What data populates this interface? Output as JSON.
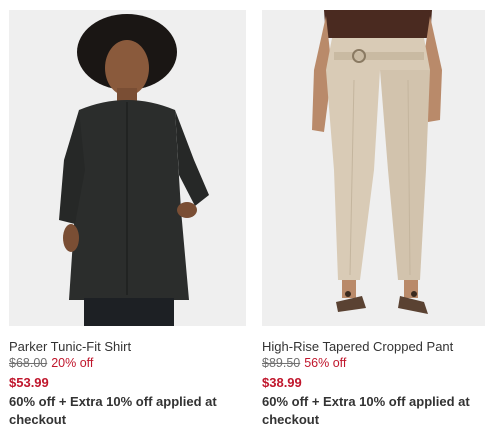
{
  "products": [
    {
      "name": "Parker Tunic-Fit Shirt",
      "original_price": "$68.00",
      "discount": "20% off",
      "sale_price": "$53.99",
      "promo": "60% off + Extra 10% off applied at checkout"
    },
    {
      "name": "High-Rise Tapered Cropped Pant",
      "original_price": "$89.50",
      "discount": "56% off",
      "sale_price": "$38.99",
      "promo": "60% off + Extra 10% off applied at checkout"
    }
  ],
  "colors": {
    "sale_red": "#c0162c",
    "text": "#333333",
    "strike_gray": "#707070",
    "image_bg": "#efefef"
  }
}
